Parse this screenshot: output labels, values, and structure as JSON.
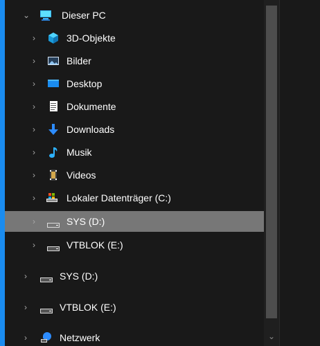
{
  "navigation": {
    "items": [
      {
        "label": "Dieser PC",
        "expanded": true,
        "icon": "computer-icon"
      },
      {
        "label": "3D-Objekte",
        "icon": "cube-icon"
      },
      {
        "label": "Bilder",
        "icon": "picture-icon"
      },
      {
        "label": "Desktop",
        "icon": "desktop-icon"
      },
      {
        "label": "Dokumente",
        "icon": "document-icon"
      },
      {
        "label": "Downloads",
        "icon": "download-arrow-icon"
      },
      {
        "label": "Musik",
        "icon": "music-note-icon"
      },
      {
        "label": "Videos",
        "icon": "film-icon"
      },
      {
        "label": "Lokaler Datenträger (C:)",
        "icon": "system-drive-icon"
      },
      {
        "label": "SYS (D:)",
        "icon": "drive-icon",
        "selected": true
      },
      {
        "label": "VTBLOK (E:)",
        "icon": "drive-icon"
      },
      {
        "label": "SYS (D:)",
        "icon": "drive-icon"
      },
      {
        "label": "VTBLOK (E:)",
        "icon": "drive-icon"
      },
      {
        "label": "Netzwerk",
        "icon": "network-icon"
      }
    ]
  },
  "colors": {
    "accent": "#1a8cf0",
    "background": "#191919",
    "selected": "#777777",
    "text": "#ffffff"
  }
}
